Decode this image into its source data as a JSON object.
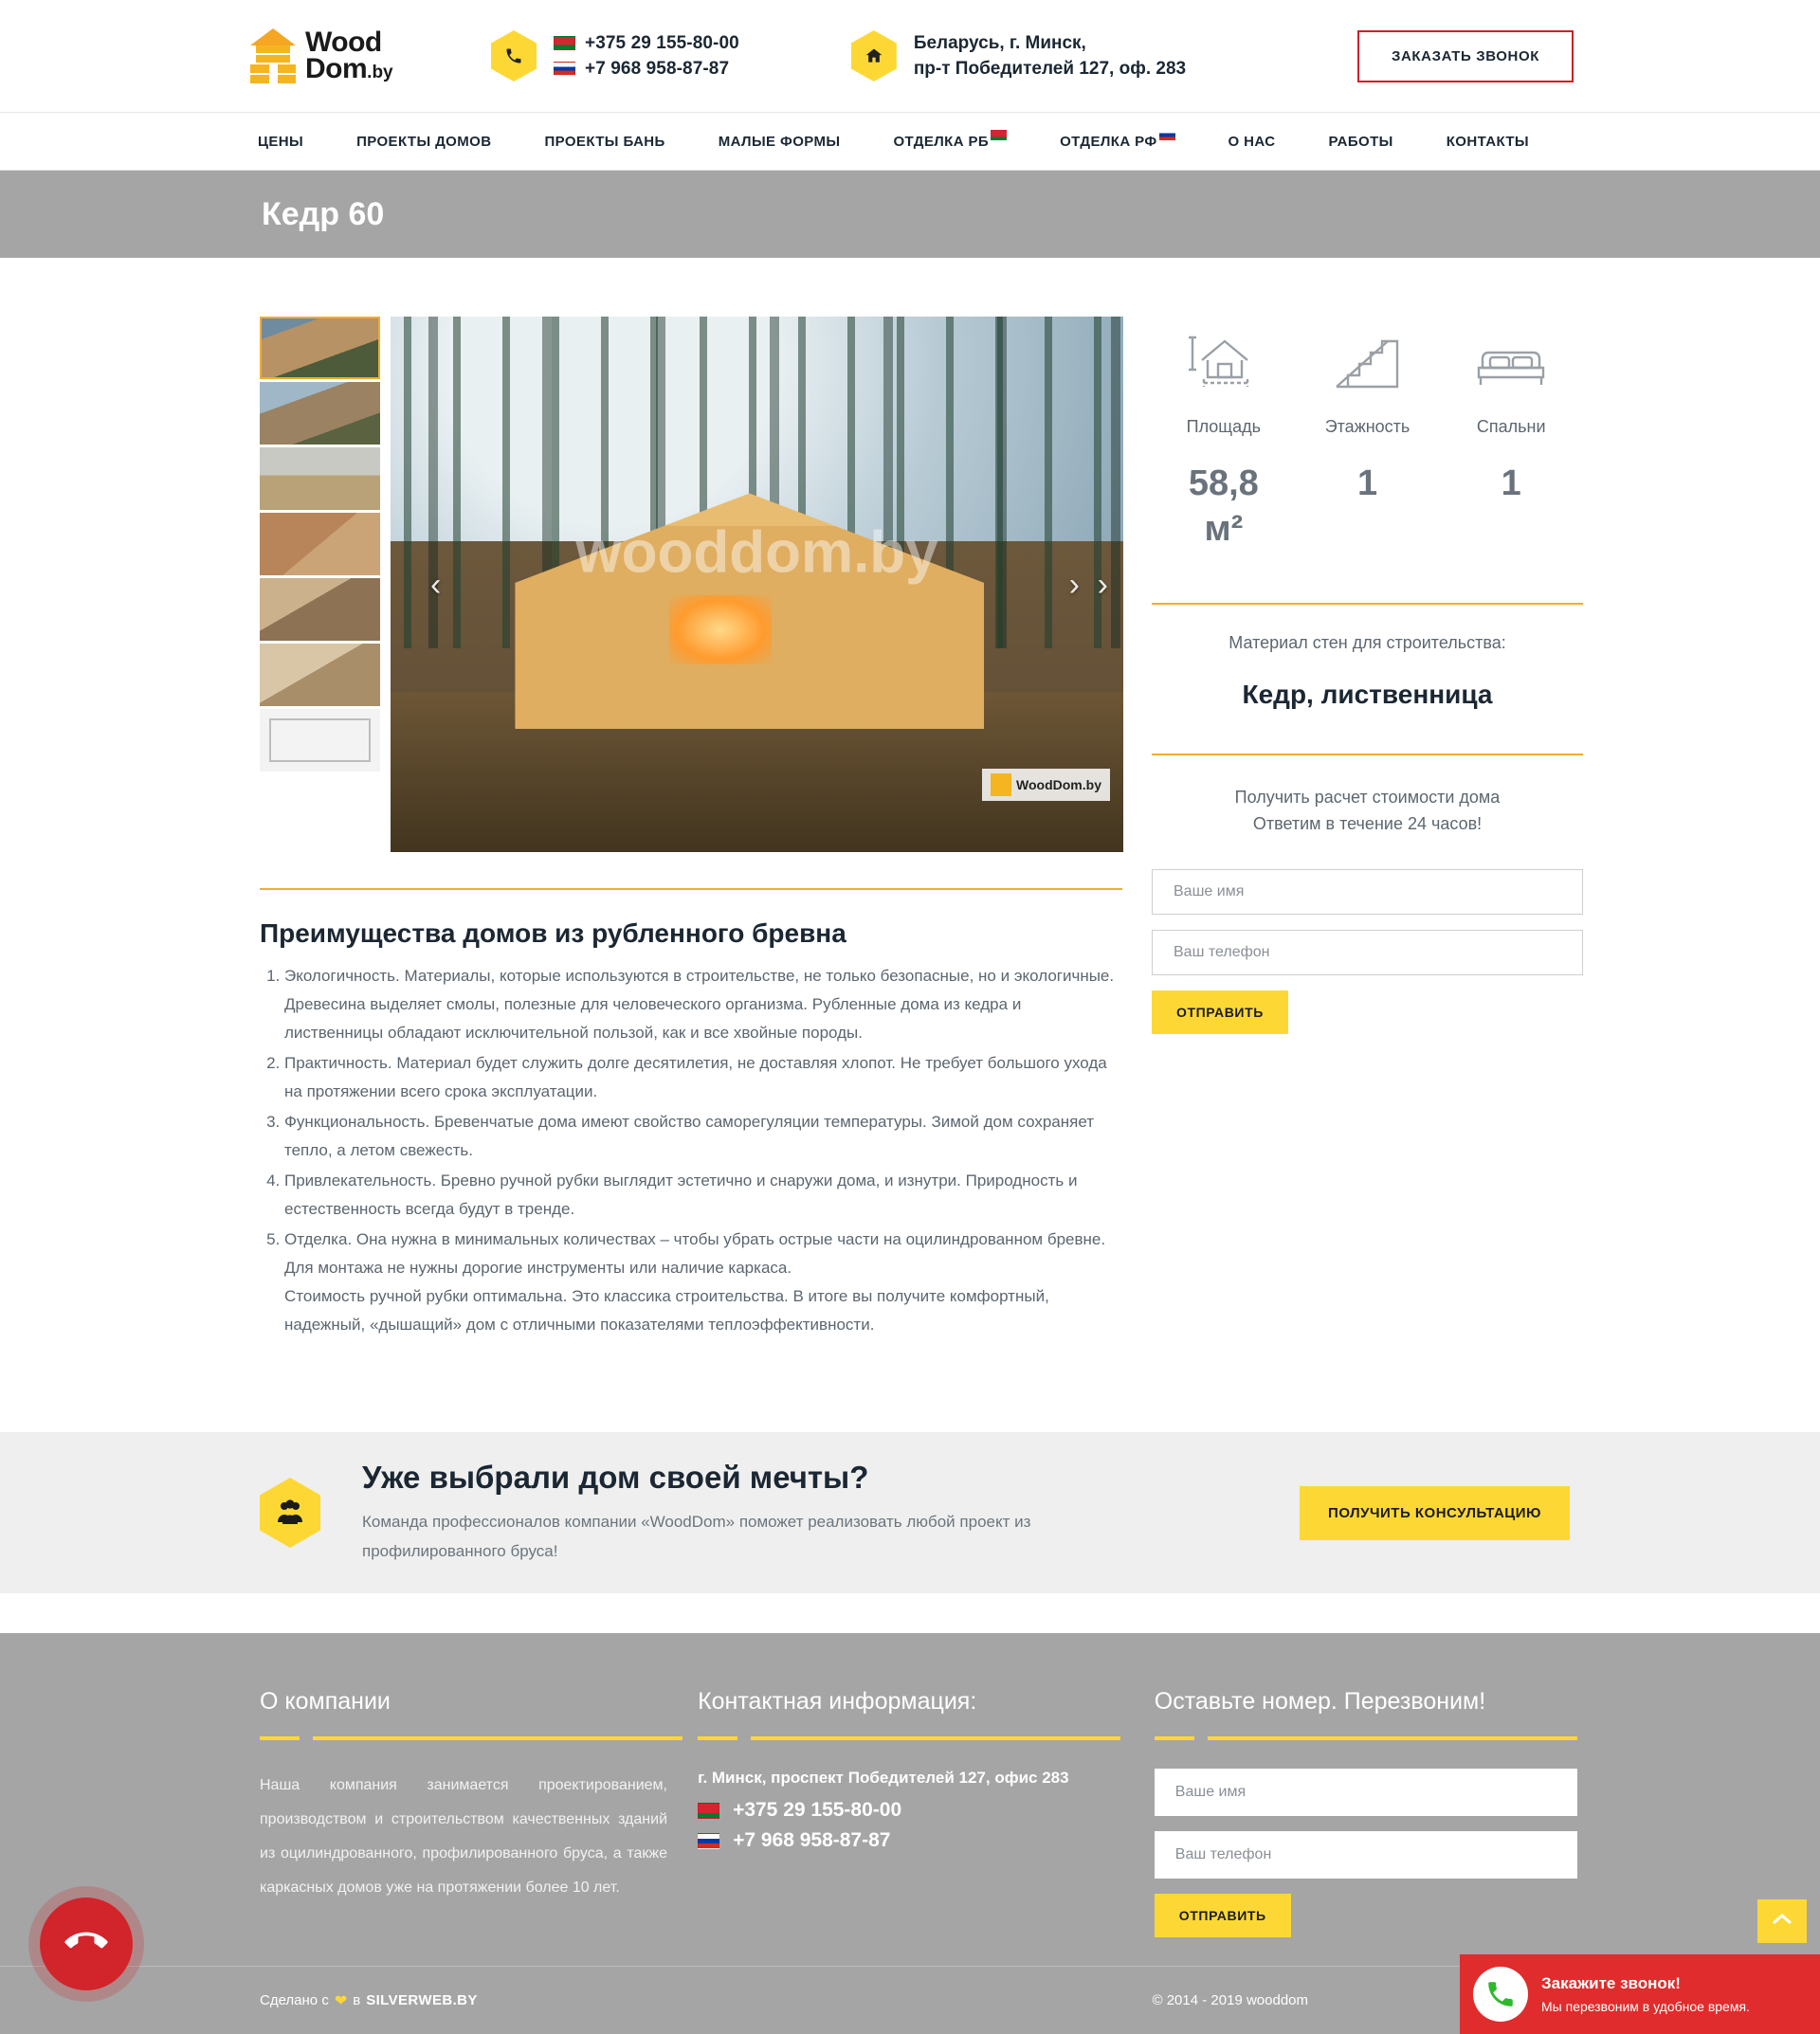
{
  "header": {
    "logo": {
      "wood": "Wood",
      "dom": "Dom",
      "by": ".by",
      "icon": "house-logo-icon"
    },
    "phone_icon": "phone-icon",
    "address_icon": "home-icon",
    "phones": [
      {
        "flag": "by",
        "number": "+375 29 155-80-00"
      },
      {
        "flag": "ru",
        "number": "+7 968 958-87-87"
      }
    ],
    "address_line1": "Беларусь, г. Минск,",
    "address_line2": "пр-т Победителей 127, оф. 283",
    "callback_button": "ЗАКАЗАТЬ ЗВОНОК"
  },
  "nav": {
    "items": [
      {
        "label": "ЦЕНЫ",
        "flag": ""
      },
      {
        "label": "ПРОЕКТЫ ДОМОВ",
        "flag": ""
      },
      {
        "label": "ПРОЕКТЫ БАНЬ",
        "flag": ""
      },
      {
        "label": "МАЛЫЕ ФОРМЫ",
        "flag": ""
      },
      {
        "label": "ОТДЕЛКА РБ",
        "flag": "by"
      },
      {
        "label": "ОТДЕЛКА РФ",
        "flag": "ru"
      },
      {
        "label": "О НАС",
        "flag": ""
      },
      {
        "label": "РАБОТЫ",
        "flag": ""
      },
      {
        "label": "КОНТАКТЫ",
        "flag": ""
      }
    ]
  },
  "page": {
    "title": "Кедр 60"
  },
  "gallery": {
    "thumbs": [
      "thumbnail-exterior-1",
      "thumbnail-exterior-2",
      "thumbnail-exterior-3",
      "thumbnail-interior-1",
      "thumbnail-interior-2",
      "thumbnail-interior-3",
      "thumbnail-floorplan"
    ],
    "watermark": "wooddom.by",
    "hero_logo": "WoodDom.by",
    "prev_icon": "chevron-left-icon",
    "next_icon": "chevron-right-icon"
  },
  "specs": [
    {
      "icon": "house-area-icon",
      "label": "Площадь",
      "value": "58,8",
      "unit": "м²"
    },
    {
      "icon": "stairs-icon",
      "label": "Этажность",
      "value": "1",
      "unit": ""
    },
    {
      "icon": "bed-icon",
      "label": "Спальни",
      "value": "1",
      "unit": ""
    }
  ],
  "material": {
    "label": "Материал стен для строительства:",
    "value": "Кедр, лиственница"
  },
  "calc_form": {
    "line1": "Получить расчет стоимости дома",
    "line2": "Ответим в течение 24 часов!",
    "name_placeholder": "Ваше имя",
    "phone_placeholder": "Ваш телефон",
    "submit": "ОТПРАВИТЬ"
  },
  "advantages": {
    "title": "Преимущества домов из рубленного бревна",
    "items": [
      "Экологичность. Материалы, которые используются в строительстве, не только безопасные, но и экологичные. Древесина выделяет смолы, полезные для человеческого организма. Рубленные дома из кедра и лиственницы обладают исключительной пользой, как и все хвойные породы.",
      "Практичность. Материал будет служить долге десятилетия, не доставляя хлопот. Не требует большого ухода на протяжении всего срока эксплуатации.",
      "Функциональность. Бревенчатые дома имеют свойство саморегуляции температуры. Зимой дом сохраняет тепло, а летом свежесть.",
      "Привлекательность. Бревно ручной рубки выглядит эстетично и снаружи дома, и изнутри. Природность и естественность всегда будут в тренде.",
      "Отделка. Она нужна в минимальных количествах – чтобы убрать острые части на оцилиндрованном бревне. Для монтажа не нужны дорогие инструменты или наличие каркаса."
    ],
    "closing": "Стоимость ручной рубки оптимальна. Это классика строительства. В итоге вы получите комфортный, надежный, «дышащий» дом с отличными показателями теплоэффективности."
  },
  "cta": {
    "icon": "team-icon",
    "heading": "Уже выбрали дом своей мечты?",
    "text": "Команда профессионалов компании «WoodDom» поможет реализовать любой проект из профилированного бруса!",
    "button": "ПОЛУЧИТЬ КОНСУЛЬТАЦИЮ"
  },
  "footer": {
    "about": {
      "heading": "О компании",
      "text": "Наша компания занимается проектированием, производством и строительством качественных зданий из оцилиндрованного, профилированного бруса, а также каркасных домов уже на протяжении более 10 лет."
    },
    "contacts": {
      "heading": "Контактная информация:",
      "address": "г. Минск, проспект Победителей 127, офис 283",
      "phones": [
        {
          "flag": "by",
          "number": "+375 29 155-80-00"
        },
        {
          "flag": "ru",
          "number": "+7 968 958-87-87"
        }
      ]
    },
    "callback": {
      "heading": "Оставьте номер. Перезвоним!",
      "name_placeholder": "Ваше имя",
      "phone_placeholder": "Ваш телефон",
      "submit": "ОТПРАВИТЬ"
    },
    "bottom": {
      "made_prefix": "Сделано с",
      "heart_icon": "heart-icon",
      "made_mid": "в",
      "made_brand": "SILVERWEB.BY",
      "copyright": "© 2014 - 2019 wooddom"
    }
  },
  "widgets": {
    "fab": {
      "icon": "phone-hangup-icon"
    },
    "toast": {
      "icon": "phone-ring-icon",
      "title": "Закажите звонок!",
      "subtitle": "Мы перезвоним в удобное время."
    },
    "scrolltop": {
      "icon": "chevron-up-icon"
    }
  },
  "colors": {
    "yellow": "#fdd835",
    "orange": "#f0ad31",
    "red": "#d2242b",
    "gray": "#a5a5a5"
  }
}
